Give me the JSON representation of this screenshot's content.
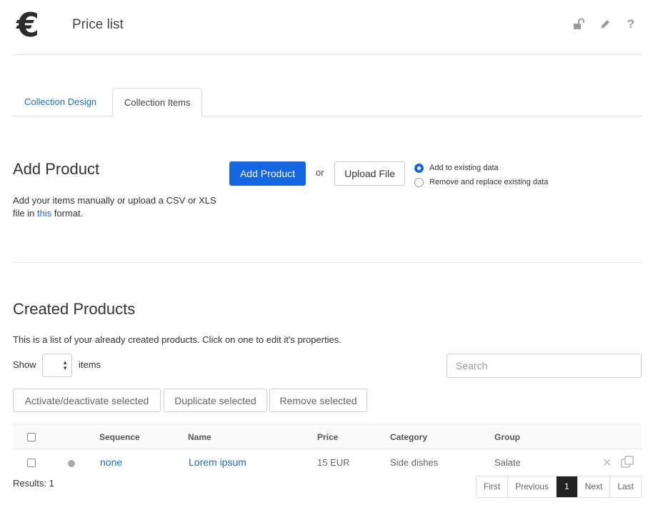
{
  "header": {
    "logo_symbol": "€",
    "title": "Price list",
    "icons": [
      "unlock-icon",
      "pencil-icon",
      "help-icon"
    ]
  },
  "tabs": [
    {
      "label": "Collection Design",
      "active": false
    },
    {
      "label": "Collection Items",
      "active": true
    }
  ],
  "add_product": {
    "title": "Add Product",
    "desc_before": "Add your items manually or upload a CSV or XLS file in ",
    "desc_link": "this",
    "desc_after": " format.",
    "add_button": "Add Product",
    "or_text": "or",
    "upload_button": "Upload File",
    "options": [
      {
        "label": "Add to existing data",
        "checked": true
      },
      {
        "label": "Remove and replace existing data",
        "checked": false
      }
    ]
  },
  "created": {
    "title": "Created Products",
    "desc": "This is a list of your already created products. Click on one to edit it's properties.",
    "show_label": "Show",
    "show_value": "",
    "items_label": "items",
    "search_placeholder": "Search",
    "bulk_actions": {
      "activate": "Activate/deactivate selected",
      "duplicate": "Duplicate selected",
      "remove": "Remove selected"
    }
  },
  "table": {
    "columns": [
      "Sequence",
      "Name",
      "Price",
      "Category",
      "Group"
    ],
    "rows": [
      {
        "sequence": "none",
        "name": "Lorem ipsum",
        "price": "15 EUR",
        "category": "Side dishes",
        "group": "Salate",
        "status_color": "#aaaaaa"
      }
    ]
  },
  "results": "Results: 1",
  "pagination": {
    "first": "First",
    "previous": "Previous",
    "current": "1",
    "next": "Next",
    "last": "Last"
  },
  "colors": {
    "primary": "#1467e0",
    "link": "#1a6fc4",
    "active_page": "#222222"
  }
}
